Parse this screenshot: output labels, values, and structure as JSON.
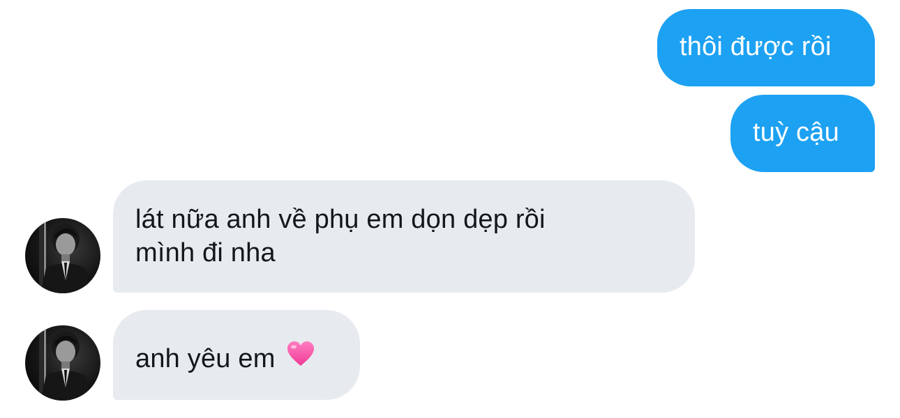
{
  "messages": [
    {
      "direction": "sent",
      "text": "thôi được rồi"
    },
    {
      "direction": "sent",
      "text": "tuỳ cậu"
    },
    {
      "direction": "received",
      "line1": "lát nữa anh về phụ em dọn dẹp rồi",
      "line2": "mình đi nha"
    },
    {
      "direction": "received",
      "text": "anh yêu em",
      "emoji": "pink-heart-icon"
    }
  ],
  "colors": {
    "sent_bubble": "#1da1f2",
    "received_bubble": "#e7ebef",
    "received_text": "#14171a",
    "heart": "#ff4fa0"
  }
}
